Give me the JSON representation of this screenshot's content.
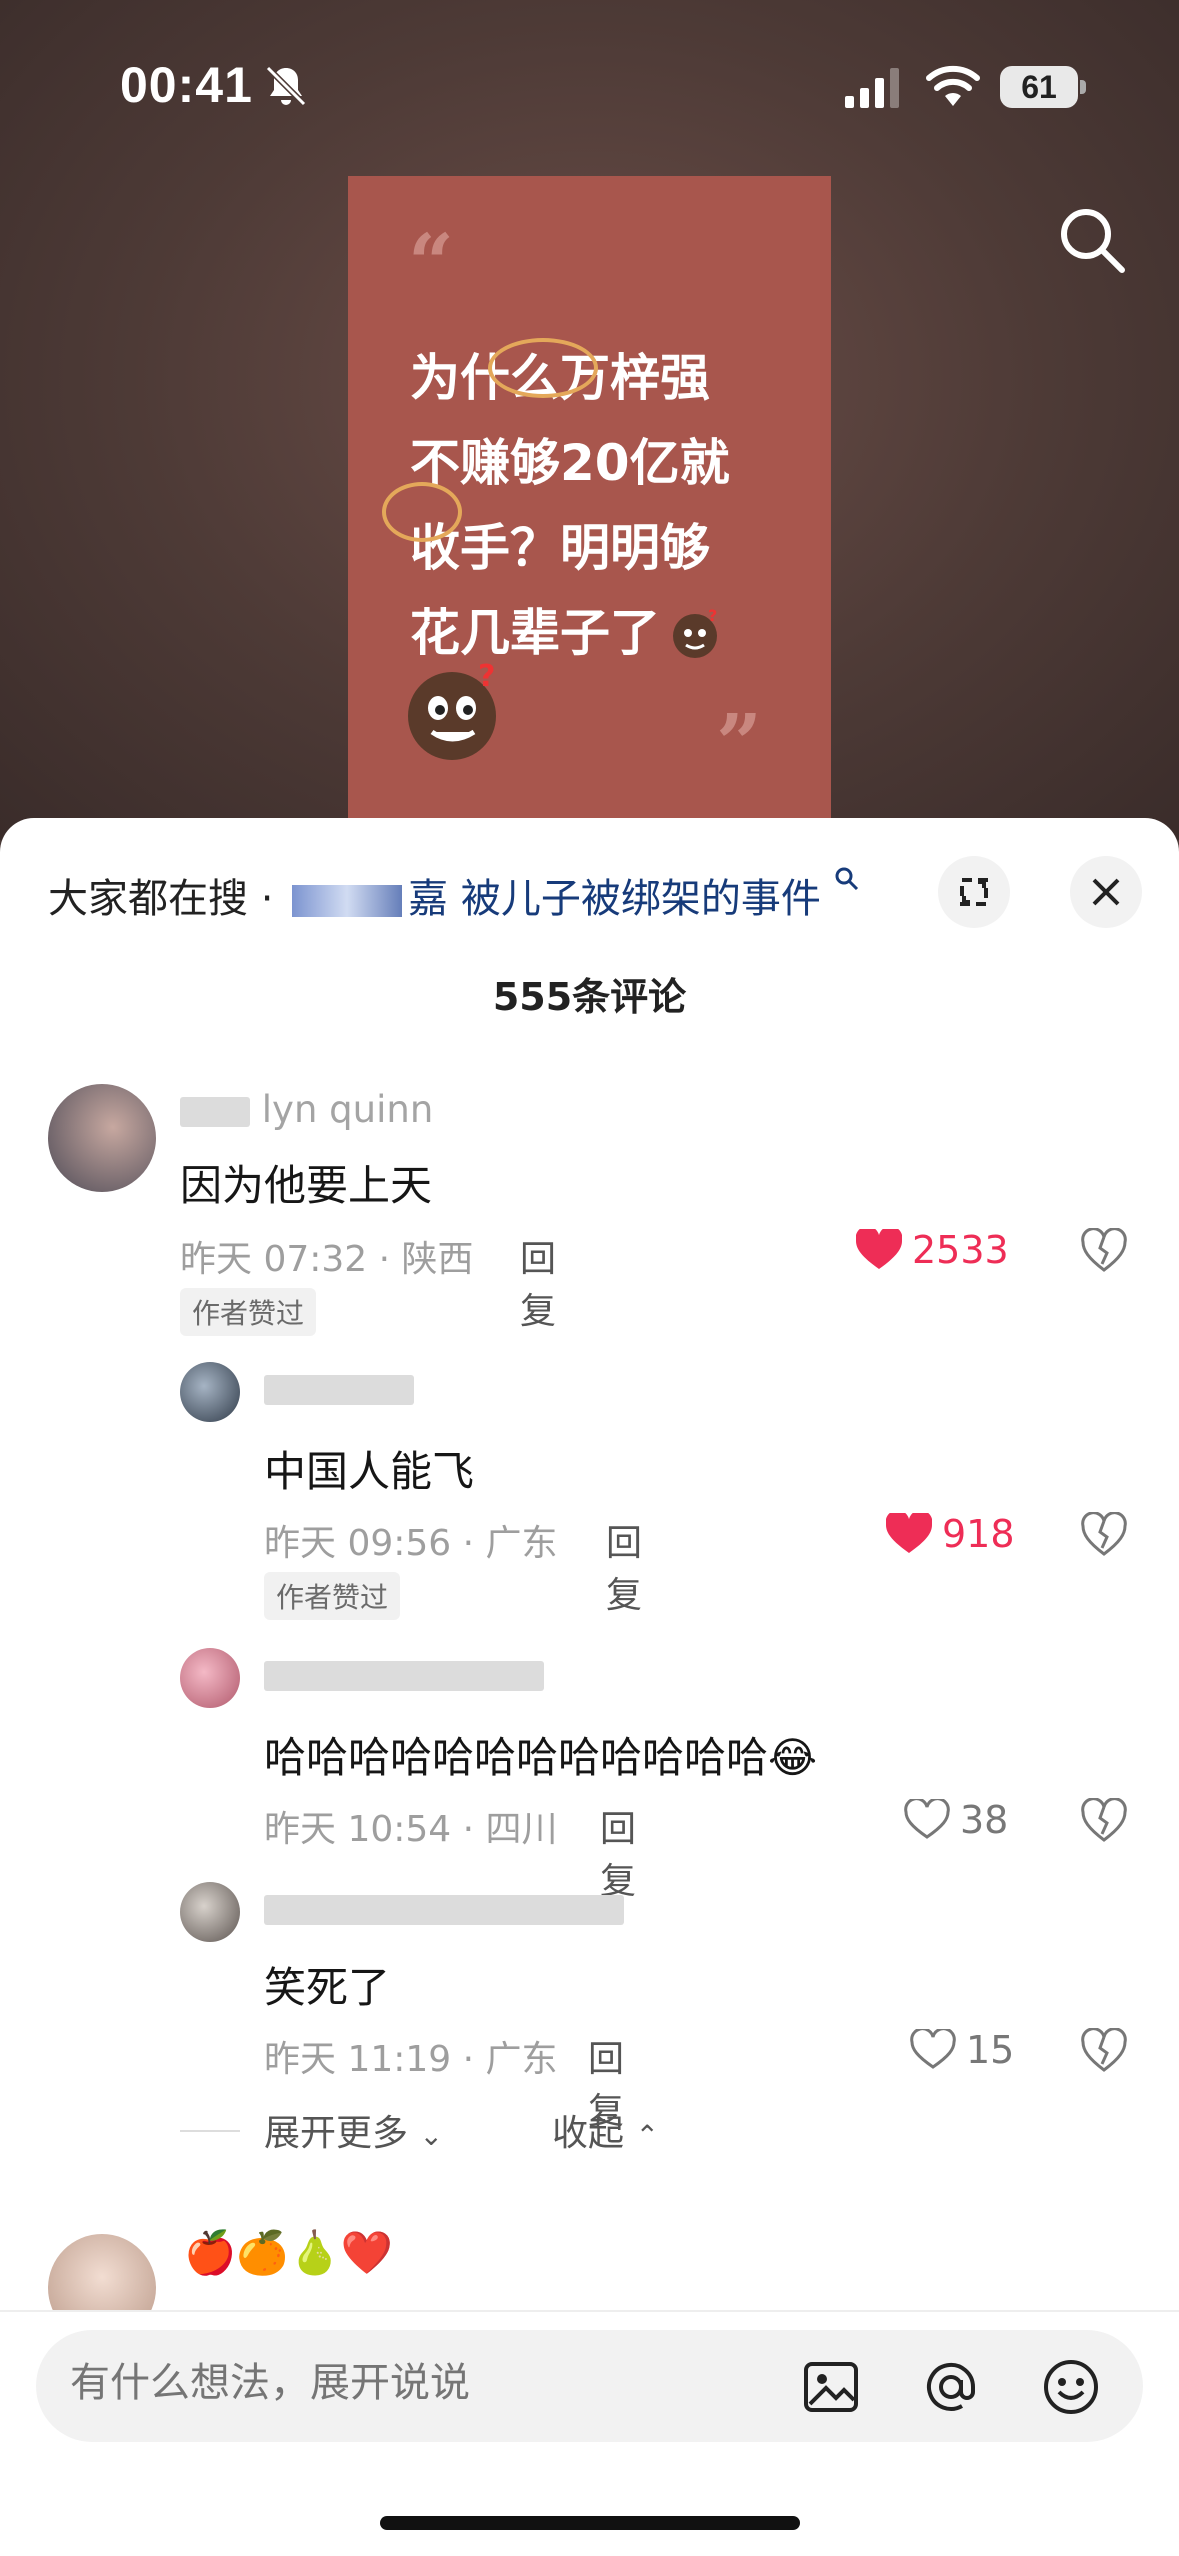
{
  "status": {
    "time": "00:41",
    "battery": "61"
  },
  "video": {
    "card_text_lines": [
      "为什么万梓强",
      "不赚够20亿就",
      "收手？明明够",
      "花几辈子了"
    ],
    "quote_open": "“",
    "quote_close": "”"
  },
  "sheet": {
    "trend_prefix": "大家都在搜 · ",
    "trend_query": "嘉 被儿子被绑架的事件",
    "comment_count": "555条评论"
  },
  "comments": [
    {
      "user": "lyn quinn",
      "text": "因为他要上天",
      "meta": "昨天 07:32 · 陕西",
      "reply": "回复",
      "likes": "2533",
      "liked": true,
      "badge": "作者赞过"
    },
    {
      "user": "",
      "text": "中国人能飞",
      "meta": "昨天 09:56 · 广东",
      "reply": "回复",
      "likes": "918",
      "liked": true,
      "badge": "作者赞过"
    },
    {
      "user": "",
      "text": "哈哈哈哈哈哈哈哈哈哈哈哈😂",
      "meta": "昨天 10:54 · 四川",
      "reply": "回复",
      "likes": "38",
      "liked": false
    },
    {
      "user": "",
      "text": "笑死了",
      "meta": "昨天 11:19 · 广东",
      "reply": "回复",
      "likes": "15",
      "liked": false
    }
  ],
  "thread_controls": {
    "expand_more": "展开更多",
    "collapse": "收起"
  },
  "next_comment": {
    "text": "🍎🍊🍐❤️"
  },
  "input": {
    "placeholder": "有什么想法，展开说说"
  },
  "colors": {
    "like_red": "#ee2d56",
    "card_bg": "#a8564d",
    "sheet_bg": "#ffffff"
  }
}
